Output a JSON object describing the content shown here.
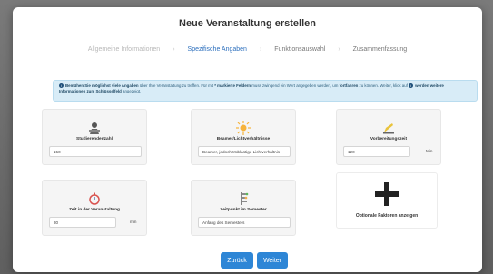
{
  "modal": {
    "title": "Neue Veranstaltung erstellen"
  },
  "steps": [
    {
      "label": "Allgemeine Informationen",
      "state": "done"
    },
    {
      "label": "Spezifische Angaben",
      "state": "active"
    },
    {
      "label": "Funktionsauswahl",
      "state": "pending"
    },
    {
      "label": "Zusammenfassung",
      "state": "pending"
    }
  ],
  "info": {
    "p1": "Bemühen Sie möglichst viele Angaben",
    "p2": " über Ihre Veranstaltung zu treffen. Für mit ",
    "p3": "* markierte Feldern",
    "p4": " muss zwingend ein Wert angegeben werden, um ",
    "p5": "fortfahren",
    "p6": " zu können. Weiter, klick auf ",
    "p7": "werden weitere Informationen zum Schlüsselfeld",
    "p8": " angezeigt."
  },
  "cards": [
    {
      "label": "Studierendenzahl",
      "value": "150",
      "unit": "",
      "icon": "student-icon"
    },
    {
      "label": "Beamer/Lichtverhältnisse",
      "value": "Beamer, jedoch trüblastige Lichtverhältnis",
      "unit": "",
      "icon": "sun-icon"
    },
    {
      "label": "Vorbereitungszeit",
      "value": "120",
      "unit": "Min",
      "icon": "pencil-icon"
    },
    {
      "label": "Zeit in der Veranstaltung",
      "value": "30",
      "unit": "min",
      "icon": "stopwatch-icon"
    },
    {
      "label": "Zeitpunkt im Semester",
      "value": "Anfang des Semesters",
      "unit": "",
      "icon": "timeline-icon"
    }
  ],
  "add_card": {
    "label": "Optionale Faktoren anzeigen",
    "icon": "plus-icon"
  },
  "buttons": {
    "back": "Zurück",
    "next": "Weiter"
  },
  "colors": {
    "accent": "#2e86d6",
    "info_bg": "#d8ecf7"
  }
}
